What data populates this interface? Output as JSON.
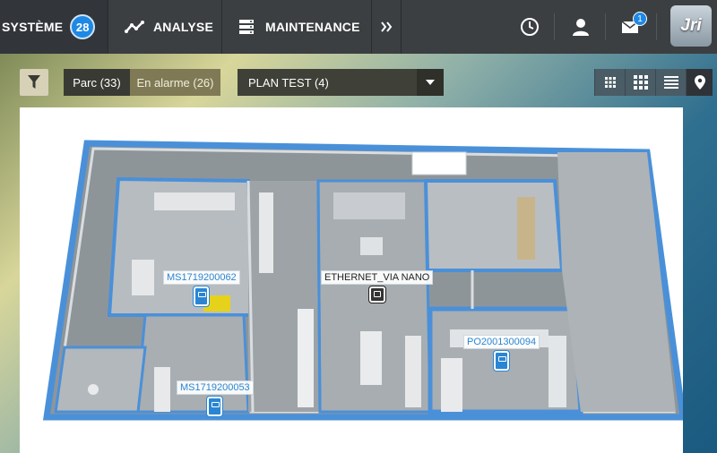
{
  "nav": {
    "items": [
      {
        "label": "SYSTÈME",
        "badge": "28",
        "icon": "system"
      },
      {
        "label": "ANALYSE",
        "icon": "chart-line-icon"
      },
      {
        "label": "MAINTENANCE",
        "icon": "server-icon"
      }
    ],
    "more_icon": "double-chevron-icon",
    "right": {
      "clock_icon": "clock-icon",
      "user_icon": "user-icon",
      "mail_icon": "mail-icon",
      "mail_badge": "1",
      "logo_text": "Jri"
    }
  },
  "toolbar": {
    "filter_icon": "filter-icon",
    "tabs": [
      {
        "label": "Parc (33)",
        "active": true
      },
      {
        "label": "En alarme (26)",
        "active": false
      }
    ],
    "plan_select": {
      "value": "PLAN TEST (4)"
    },
    "views": [
      "grid-small-icon",
      "grid-large-icon",
      "list-icon",
      "map-pin-icon"
    ],
    "active_view": 3
  },
  "plan": {
    "sensors": [
      {
        "id": "MS1719200062",
        "type": "blue"
      },
      {
        "id": "ETHERNET_VIA NANO",
        "type": "dark"
      },
      {
        "id": "PO2001300094",
        "type": "blue"
      },
      {
        "id": "MS1719200053",
        "type": "blue"
      }
    ]
  }
}
